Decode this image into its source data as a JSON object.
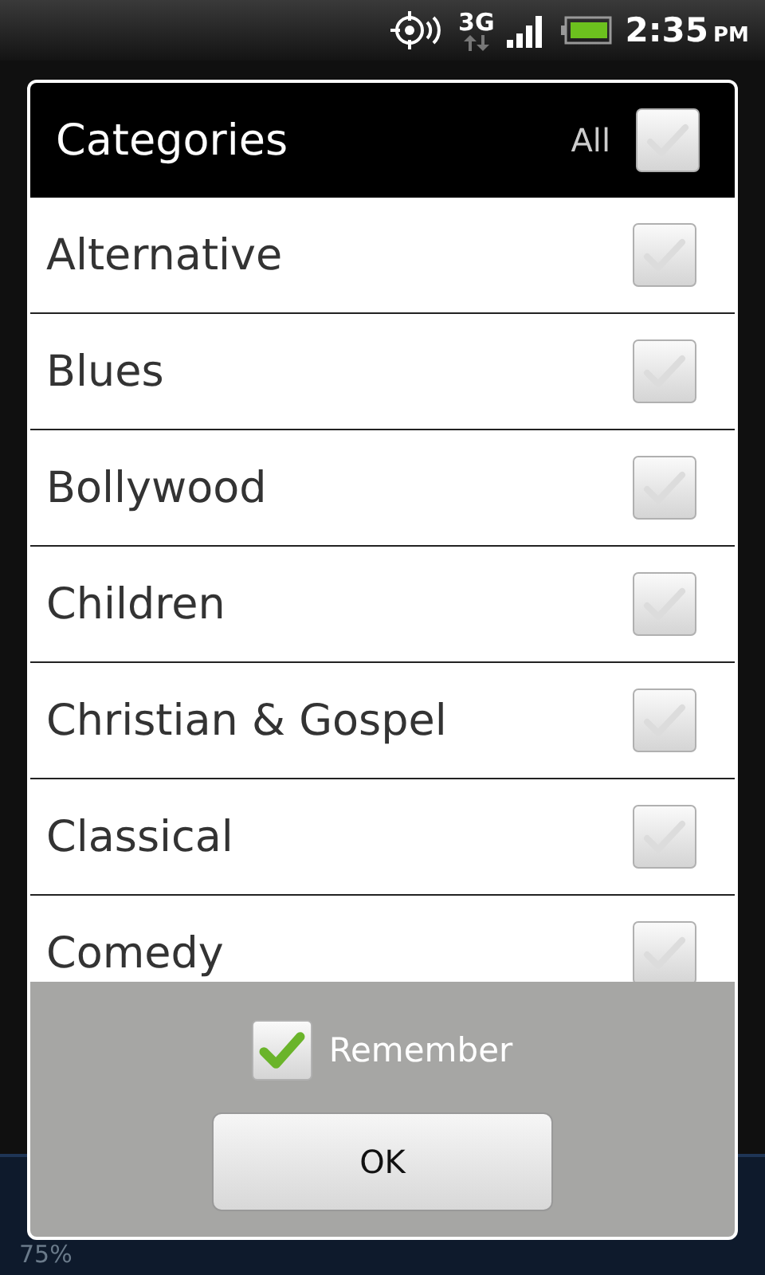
{
  "status_bar": {
    "network": "3G",
    "time": "2:35",
    "meridiem": "PM"
  },
  "background": {
    "reading": "75%"
  },
  "dialog": {
    "title": "Categories",
    "all_label": "All",
    "all_checked": false,
    "items": [
      {
        "label": "Alternative",
        "checked": false
      },
      {
        "label": "Blues",
        "checked": false
      },
      {
        "label": "Bollywood",
        "checked": false
      },
      {
        "label": "Children",
        "checked": false
      },
      {
        "label": "Christian & Gospel",
        "checked": false
      },
      {
        "label": "Classical",
        "checked": false
      },
      {
        "label": "Comedy",
        "checked": false
      }
    ],
    "remember": {
      "label": "Remember",
      "checked": true
    },
    "ok_button": "OK"
  }
}
